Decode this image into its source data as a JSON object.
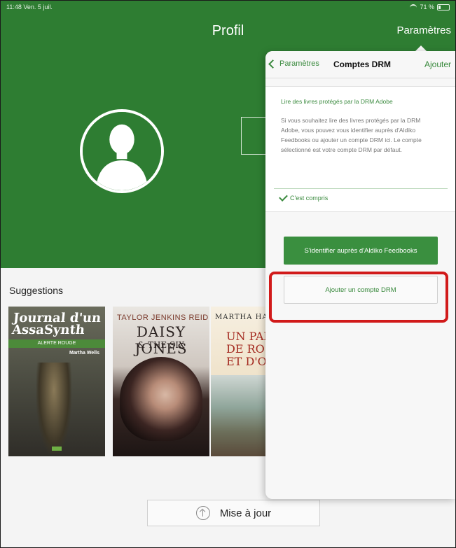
{
  "status_bar": {
    "time_date": "11:48  Ven. 5 juil.",
    "battery": "71 %"
  },
  "header": {
    "title": "Profil",
    "settings_label": "Paramètres"
  },
  "suggestions": {
    "title": "Suggestions",
    "books": [
      {
        "title": "Journal d'un AssaSynth",
        "band": "ALERTE ROUGE",
        "author": "Martha Wells"
      },
      {
        "author": "TAYLOR JENKINS REID",
        "title": "DAISY JONES",
        "subtitle": "& THE SIX"
      },
      {
        "author": "MARTHA HA",
        "title": "UN PAR\nDE RO\nET D'OU"
      }
    ]
  },
  "update_button": {
    "label": "Mise à jour",
    "icon": "upload-circle-icon"
  },
  "popover": {
    "back_label": "Paramètres",
    "title": "Comptes DRM",
    "add_label": "Ajouter",
    "info_heading": "Lire des livres protégés par la DRM Adobe",
    "info_body": "Si vous souhaitez lire des livres protégés par la DRM Adobe, vous pouvez vous identifier auprès d'Aldiko Feedbooks ou ajouter un compte DRM ici. Le compte sélectionné est votre compte DRM par défaut.",
    "ack_label": "C'est compris",
    "login_button": "S'identifier auprès d'Aldiko Feedbooks",
    "add_drm_button": "Ajouter un compte DRM"
  },
  "colors": {
    "brand_green": "#2e7d32",
    "accent_green": "#3a8a3e",
    "highlight_red": "#d11a1a"
  }
}
